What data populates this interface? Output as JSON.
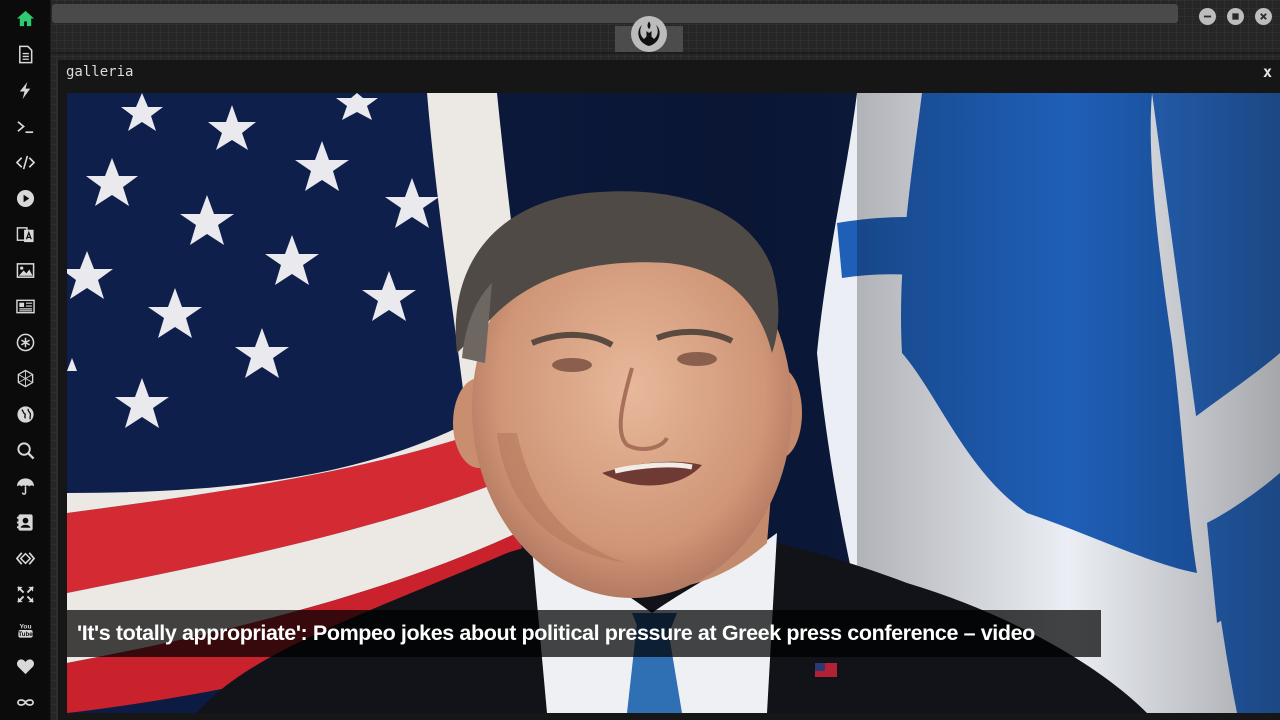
{
  "sidebar": {
    "items": [
      {
        "name": "home-icon",
        "active": true
      },
      {
        "name": "document-icon"
      },
      {
        "name": "lightning-icon"
      },
      {
        "name": "terminal-icon"
      },
      {
        "name": "code-icon"
      },
      {
        "name": "play-icon"
      },
      {
        "name": "translate-icon"
      },
      {
        "name": "image-icon"
      },
      {
        "name": "news-icon"
      },
      {
        "name": "asterisk-icon"
      },
      {
        "name": "hexagon-icon"
      },
      {
        "name": "globe-icon"
      },
      {
        "name": "search-icon"
      },
      {
        "name": "umbrella-icon"
      },
      {
        "name": "contact-icon"
      },
      {
        "name": "api-icon"
      },
      {
        "name": "expand-icon"
      },
      {
        "name": "youtube-icon"
      },
      {
        "name": "heart-icon"
      },
      {
        "name": "infinity-icon"
      }
    ],
    "active_color": "#2ecc71",
    "icon_color": "#d8d8d8"
  },
  "window": {
    "logo_icon": "rebel-alliance-icon",
    "controls": [
      "minimize-icon",
      "maximize-icon",
      "close-icon"
    ]
  },
  "panel": {
    "title": "galleria",
    "close_label": "x"
  },
  "gallery": {
    "caption": "'It's totally appropriate': Pompeo jokes about political pressure at Greek press conference – video",
    "image_subject": "man-at-press-conference-with-us-and-greek-flags"
  }
}
